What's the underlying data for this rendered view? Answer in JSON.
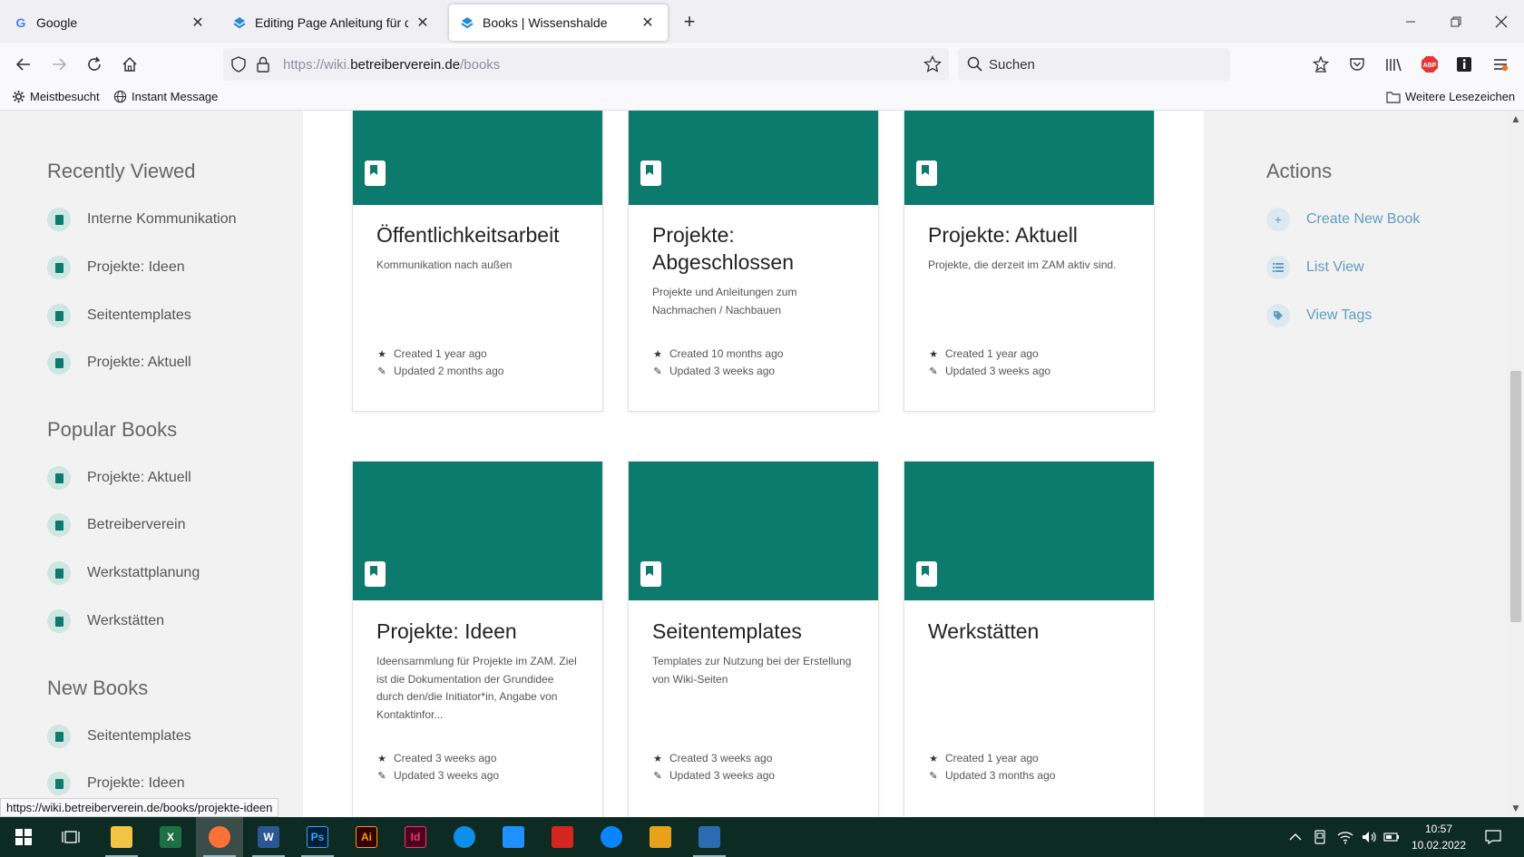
{
  "browser": {
    "tabs": [
      {
        "title": "Google",
        "active": false
      },
      {
        "title": "Editing Page Anleitung für das l",
        "active": false
      },
      {
        "title": "Books | Wissenshalde",
        "active": true
      }
    ],
    "url": {
      "prefix": "https://wiki.",
      "domain": "betreiberverein.de",
      "path": "/books"
    },
    "search_placeholder": "Suchen",
    "bookmarks": [
      {
        "label": "Meistbesucht",
        "icon": "gear-icon"
      },
      {
        "label": "Instant Message",
        "icon": "globe-icon"
      }
    ],
    "other_bookmarks": "Weitere Lesezeichen",
    "status_url": "https://wiki.betreiberverein.de/books/projekte-ideen"
  },
  "sidebar": {
    "recently_viewed": {
      "title": "Recently Viewed",
      "items": [
        "Interne Kommunikation",
        "Projekte: Ideen",
        "Seitentemplates",
        "Projekte: Aktuell"
      ]
    },
    "popular_books": {
      "title": "Popular Books",
      "items": [
        "Projekte: Aktuell",
        "Betreiberverein",
        "Werkstattplanung",
        "Werkstätten"
      ]
    },
    "new_books": {
      "title": "New Books",
      "items": [
        "Seitentemplates",
        "Projekte: Ideen"
      ]
    }
  },
  "books": [
    {
      "title": "Öffentlichkeitsarbeit",
      "description": "Kommunikation nach außen",
      "created": "Created 1 year ago",
      "updated": "Updated 2 months ago"
    },
    {
      "title": "Projekte: Abgeschlossen",
      "description": "Projekte und Anleitungen zum Nachmachen / Nachbauen",
      "created": "Created 10 months ago",
      "updated": "Updated 3 weeks ago"
    },
    {
      "title": "Projekte: Aktuell",
      "description": "Projekte, die derzeit im ZAM aktiv sind.",
      "created": "Created 1 year ago",
      "updated": "Updated 3 weeks ago"
    },
    {
      "title": "Projekte: Ideen",
      "description": "Ideensammlung für Projekte im ZAM. Ziel ist die Dokumentation der Grundidee durch den/die Initiator*in, Angabe von Kontaktinfor...",
      "created": "Created 3 weeks ago",
      "updated": "Updated 3 weeks ago"
    },
    {
      "title": "Seitentemplates",
      "description": "Templates zur Nutzung bei der Erstellung von Wiki-Seiten",
      "created": "Created 3 weeks ago",
      "updated": "Updated 3 weeks ago"
    },
    {
      "title": "Werkstätten",
      "description": "",
      "created": "Created 1 year ago",
      "updated": "Updated 3 months ago"
    }
  ],
  "actions": {
    "title": "Actions",
    "items": [
      {
        "label": "Create New Book",
        "icon": "plus-icon"
      },
      {
        "label": "List View",
        "icon": "list-icon"
      },
      {
        "label": "View Tags",
        "icon": "tag-icon"
      }
    ]
  },
  "taskbar": {
    "time": "10:57",
    "date": "10.02.2022",
    "apps": [
      {
        "name": "file-explorer-icon",
        "label": "",
        "color": "#f3c343"
      },
      {
        "name": "excel-icon",
        "label": "X",
        "color": "#1d7044"
      },
      {
        "name": "firefox-icon",
        "label": "",
        "color": "#ff7139"
      },
      {
        "name": "word-icon",
        "label": "W",
        "color": "#2b5797"
      },
      {
        "name": "photoshop-icon",
        "label": "Ps",
        "color": "#001e36"
      },
      {
        "name": "illustrator-icon",
        "label": "Ai",
        "color": "#330000"
      },
      {
        "name": "indesign-icon",
        "label": "Id",
        "color": "#49021f"
      },
      {
        "name": "teamviewer-icon",
        "label": "",
        "color": "#0e8ee9"
      },
      {
        "name": "app-n-icon",
        "label": "",
        "color": "#1e90ff"
      },
      {
        "name": "acrobat-icon",
        "label": "",
        "color": "#d4261f"
      },
      {
        "name": "thunderbird-icon",
        "label": "",
        "color": "#0a84ff"
      },
      {
        "name": "grid-app-icon",
        "label": "",
        "color": "#e8a21a"
      },
      {
        "name": "document-app-icon",
        "label": "",
        "color": "#2b6cb0"
      }
    ]
  },
  "colors": {
    "book_cover": "#0c7a6c",
    "action_link": "#5f9dc0",
    "taskbar": "#0d2b22"
  }
}
